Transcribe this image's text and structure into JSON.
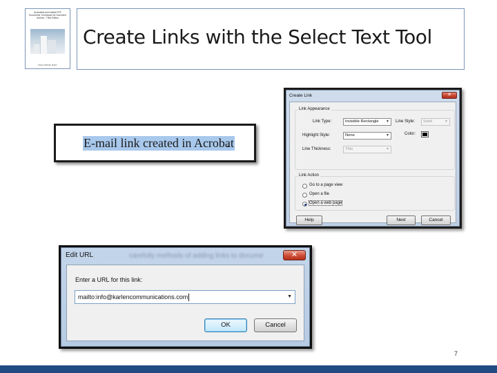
{
  "slide": {
    "title": "Create Links with the Select Text Tool",
    "page_number": "7"
  },
  "book_cover": {
    "title": "Accessible and Usable PDF Documents: Techniques for Document Authors - Third Edition",
    "author": "Karen McCall, M.Ed."
  },
  "email_sample": {
    "selected_text": "E-mail link created in Acrobat",
    "trailing_text": "."
  },
  "create_link_dialog": {
    "title": "Create Link",
    "close_glyph": "✕",
    "appearance_group": "Link Appearance",
    "link_type_label": "Link Type:",
    "link_type_value": "Invisible Rectangle",
    "line_style_label": "Line Style:",
    "line_style_value": "Solid",
    "highlight_style_label": "Highlight Style:",
    "highlight_style_value": "None",
    "color_label": "Color:",
    "line_thickness_label": "Line Thickness:",
    "line_thickness_value": "Thin",
    "action_group": "Link Action",
    "actions": [
      {
        "label": "Go to a page view",
        "checked": false
      },
      {
        "label": "Open a file",
        "checked": false
      },
      {
        "label": "Open a web page",
        "checked": true
      }
    ],
    "help_button": "Help",
    "next_button": "Next",
    "cancel_button": "Cancel"
  },
  "edit_url_dialog": {
    "title": "Edit URL",
    "background_text": "carefully methods of adding links to docume",
    "close_glyph": "✕",
    "prompt": "Enter a URL for this link:",
    "url_value": "mailto:info@karlencommunications.com",
    "ok_button": "OK",
    "cancel_button": "Cancel"
  },
  "colors": {
    "footer_bar": "#1f4a82",
    "selection_highlight": "#a8c8ec",
    "frame_border": "#7a95b8"
  }
}
